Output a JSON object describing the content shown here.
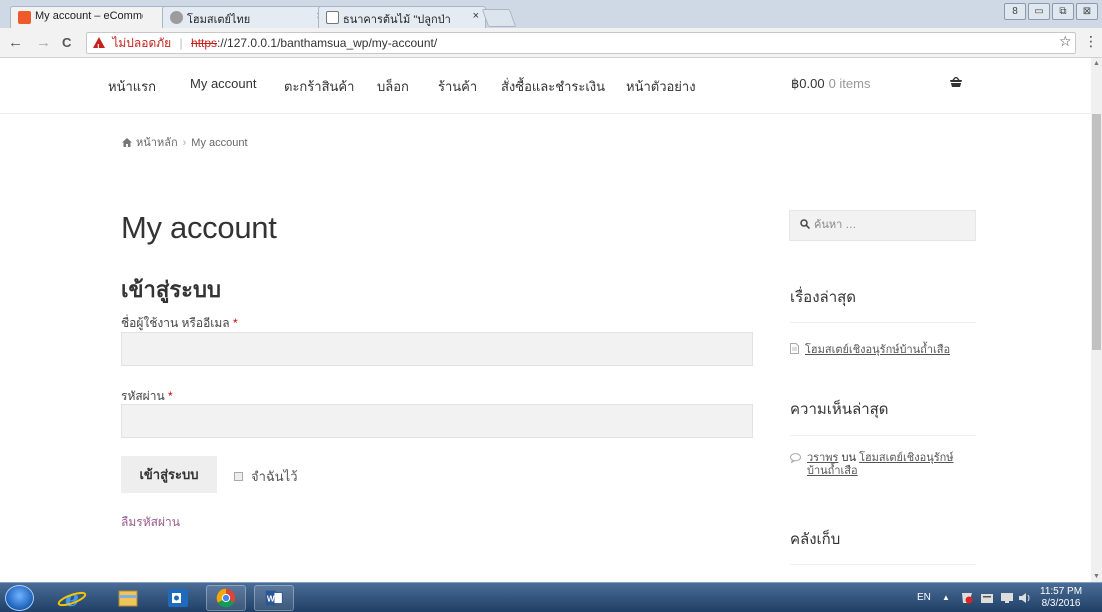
{
  "browser": {
    "tabs": [
      {
        "label": "My account – eCommerc",
        "active": true,
        "favicon_color": "#f0592a"
      },
      {
        "label": "โฮมสเตย์ไทย",
        "active": false,
        "favicon_color": "#9c9c9c"
      },
      {
        "label": "ธนาคารต้นไม้ \"ปลูกป่า ปลูกจิ",
        "active": false,
        "favicon_color": "#ffffff"
      }
    ],
    "close_glyph": "×",
    "back_glyph": "←",
    "forward_glyph": "→",
    "reload_glyph": "C",
    "address": {
      "insecure_label": "ไม่ปลอดภัย",
      "separator": "|",
      "scheme": "https",
      "rest": "://127.0.0.1/banthamsua_wp/my-account/"
    },
    "bookmark_glyph": "☆",
    "menu_glyph": "⋮",
    "window_controls": [
      "8",
      "▭",
      "⧉",
      "⊠"
    ]
  },
  "site_nav": {
    "items": [
      "หน้าแรก",
      "My account",
      "ตะกร้าสินค้า",
      "บล็อก",
      "ร้านค้า",
      "สั่งซื้อและชำระเงิน",
      "หน้าตัวอย่าง"
    ],
    "cart_total": "฿0.00",
    "cart_items": "0 items"
  },
  "breadcrumb": {
    "home": "หน้าหลัก",
    "separator": "›",
    "current": "My account"
  },
  "main": {
    "title": "My account",
    "login_heading": "เข้าสู่ระบบ",
    "username_label": "ชื่อผู้ใช้งาน หรืออีเมล",
    "password_label": "รหัสผ่าน",
    "required_mark": "*",
    "username_value": "",
    "password_value": "",
    "login_button": "เข้าสู่ระบบ",
    "remember_label": "จำฉันไว้",
    "lost_password": "ลืมรหัสผ่าน"
  },
  "sidebar": {
    "search_placeholder": "ค้นหา …",
    "recent_posts_title": "เรื่องล่าสุด",
    "recent_posts": [
      "โฮมสเตย์เชิงอนุรักษ์บ้านถ้ำเสือ"
    ],
    "recent_comments_title": "ความเห็นล่าสุด",
    "comment_author": "วราพร",
    "comment_on": "บน",
    "comment_post": "โฮมสเตย์เชิงอนุรักษ์บ้านถ้ำเสือ",
    "archives_title": "คลังเก็บ"
  },
  "taskbar": {
    "language": "EN",
    "tray_arrow": "▲",
    "time": "11:57 PM",
    "date": "8/3/2016"
  },
  "colors": {
    "link_accent": "#96588a",
    "insecure_red": "#c5221f"
  }
}
